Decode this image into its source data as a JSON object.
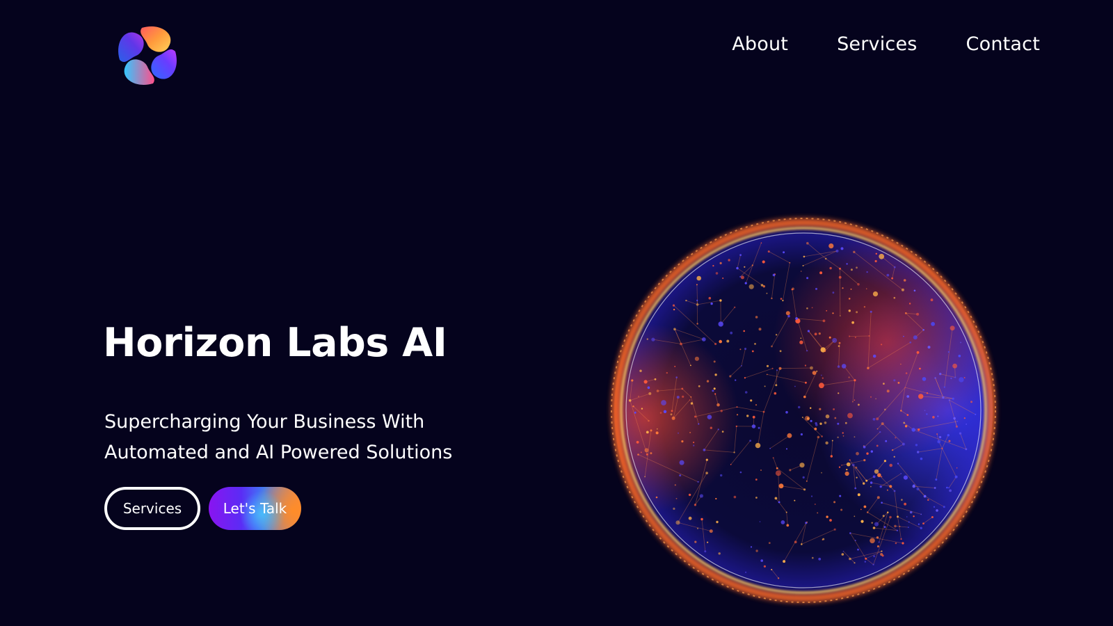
{
  "header": {
    "logo_icon": "swirl-logo-icon",
    "nav": [
      {
        "label": "About"
      },
      {
        "label": "Services"
      },
      {
        "label": "Contact"
      }
    ]
  },
  "hero": {
    "title": "Horizon Labs AI",
    "subtitle_line1": "Supercharging Your Business With",
    "subtitle_line2": "Automated and AI Powered Solutions",
    "buttons": {
      "services_label": "Services",
      "talk_label": "Let's Talk"
    },
    "visual_icon": "network-sphere-icon"
  },
  "colors": {
    "background": "#05031d",
    "text": "#ffffff",
    "accent_orange": "#ff6a2a",
    "accent_blue": "#3d3dff",
    "accent_purple": "#8a14f0"
  }
}
